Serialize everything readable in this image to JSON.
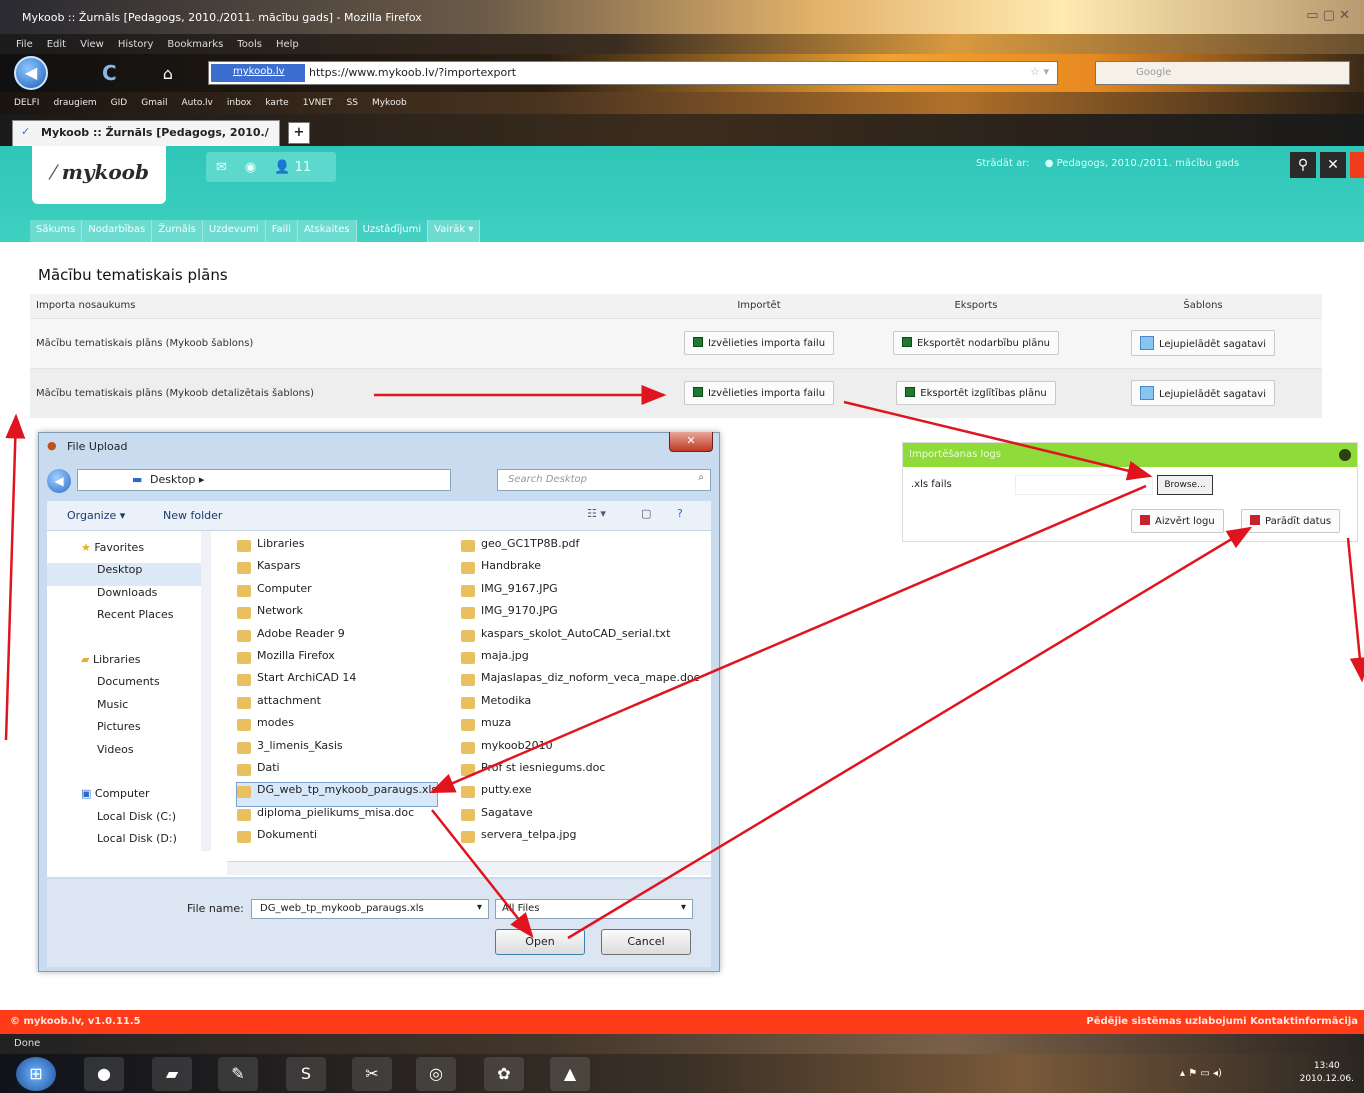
{
  "browser": {
    "window_title": "Mykoob :: Žurnāls [Pedagogs, 2010./2011. mācību gads] - Mozilla Firefox",
    "menu": [
      "File",
      "Edit",
      "View",
      "History",
      "Bookmarks",
      "Tools",
      "Help"
    ],
    "url_badge": "mykoob.lv",
    "url": "https://www.mykoob.lv/?importexport",
    "search_placeholder": "Google",
    "bookmarks": [
      "DELFI",
      "draugiem",
      "GID",
      "Gmail",
      "Auto.lv",
      "inbox",
      "karte",
      "1VNET",
      "SS",
      "Mykoob"
    ],
    "tab_label": "Mykoob :: Žurnāls [Pedagogs, 2010./",
    "status": "Done"
  },
  "app": {
    "logo": "mykoob",
    "notif_count": "11",
    "work_as": "Strādāt ar:",
    "work_as_value": "Pedagogs, 2010./2011. mācību gads",
    "nav": [
      "Sākums",
      "Nodarbības",
      "Žurnāls",
      "Uzdevumi",
      "Faili",
      "Atskaites",
      "Uzstādījumi",
      "Vairāk"
    ],
    "active_nav": "Uzstādījumi"
  },
  "page": {
    "title": "Mācību tematiskais plāns",
    "table": {
      "headers": [
        "Importa nosaukums",
        "Importēt",
        "Eksports",
        "Šablons"
      ],
      "rows": [
        {
          "name": "Mācību tematiskais plāns (Mykoob šablons)",
          "import": "Izvēlieties importa failu",
          "export": "Eksportēt nodarbību plānu",
          "template": "Lejupielādēt sagatavi"
        },
        {
          "name": "Mācību tematiskais plāns (Mykoob detalizētais šablons)",
          "import": "Izvēlieties importa failu",
          "export": "Eksportēt izglītības plānu",
          "template": "Lejupielādēt sagatavi"
        }
      ]
    },
    "import_window": {
      "title": "Importēšanas logs",
      "label": ".xls fails",
      "browse": "Browse...",
      "close": "Aizvērt logu",
      "show": "Parādīt datus"
    }
  },
  "dialog": {
    "title": "File Upload",
    "path": "Desktop",
    "search_placeholder": "Search Desktop",
    "organize": "Organize",
    "new_folder": "New folder",
    "nav": {
      "favorites": "Favorites",
      "favorite_items": [
        "Desktop",
        "Downloads",
        "Recent Places"
      ],
      "libraries": "Libraries",
      "library_items": [
        "Documents",
        "Music",
        "Pictures",
        "Videos"
      ],
      "computer": "Computer",
      "computer_items": [
        "Local Disk (C:)",
        "Local Disk (D:)"
      ]
    },
    "files_col1": [
      "Libraries",
      "Kaspars",
      "Computer",
      "Network",
      "Adobe Reader 9",
      "Mozilla Firefox",
      "Start ArchiCAD 14",
      "attachment",
      "modes",
      "3_limenis_Kasis",
      "Dati",
      "DG_web_tp_mykoob_paraugs.xls",
      "diploma_pielikums_misa.doc",
      "Dokumenti"
    ],
    "files_col2": [
      "geo_GC1TP8B.pdf",
      "Handbrake",
      "IMG_9167.JPG",
      "IMG_9170.JPG",
      "kaspars_skolot_AutoCAD_serial.txt",
      "maja.jpg",
      "Majaslapas_diz_noform_veca_mape.doc",
      "Metodika",
      "muza",
      "mykoob2010",
      "Prof st iesniegums.doc",
      "putty.exe",
      "Sagatave",
      "servera_telpa.jpg"
    ],
    "selected_file": "DG_web_tp_mykoob_paraugs.xls",
    "file_name_label": "File name:",
    "file_name_value": "DG_web_tp_mykoob_paraugs.xls",
    "file_type": "All Files",
    "open": "Open",
    "cancel": "Cancel"
  },
  "footer": {
    "left": "© mykoob.lv, v1.0.11.5",
    "right": "Pēdējie sistēmas uzlabojumi   Kontaktinformācija"
  },
  "taskbar": {
    "time": "13:40",
    "date": "2010.12.06."
  },
  "colors": {
    "accent": "#3fd0c0",
    "footer": "#ff3c1a",
    "import_bar": "#8edb3a",
    "annotation_arrow": "#e0141e"
  }
}
